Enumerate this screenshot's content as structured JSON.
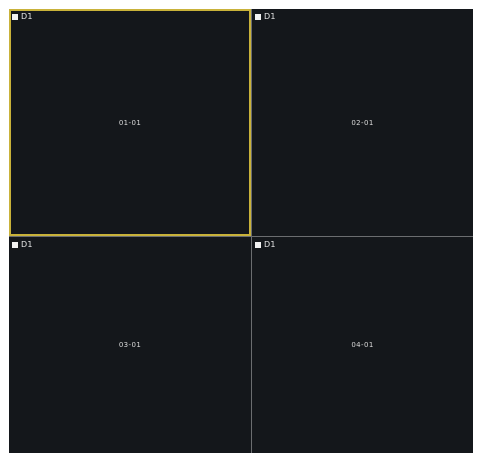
{
  "tiles": [
    {
      "resolution": "D1",
      "channel": "01-01",
      "selected": true
    },
    {
      "resolution": "D1",
      "channel": "02-01",
      "selected": false
    },
    {
      "resolution": "D1",
      "channel": "03-01",
      "selected": false
    },
    {
      "resolution": "D1",
      "channel": "04-01",
      "selected": false
    }
  ],
  "colors": {
    "tile_bg": "#14171b",
    "selected_border": "#c9b23a",
    "divider": "#6b6d70"
  }
}
